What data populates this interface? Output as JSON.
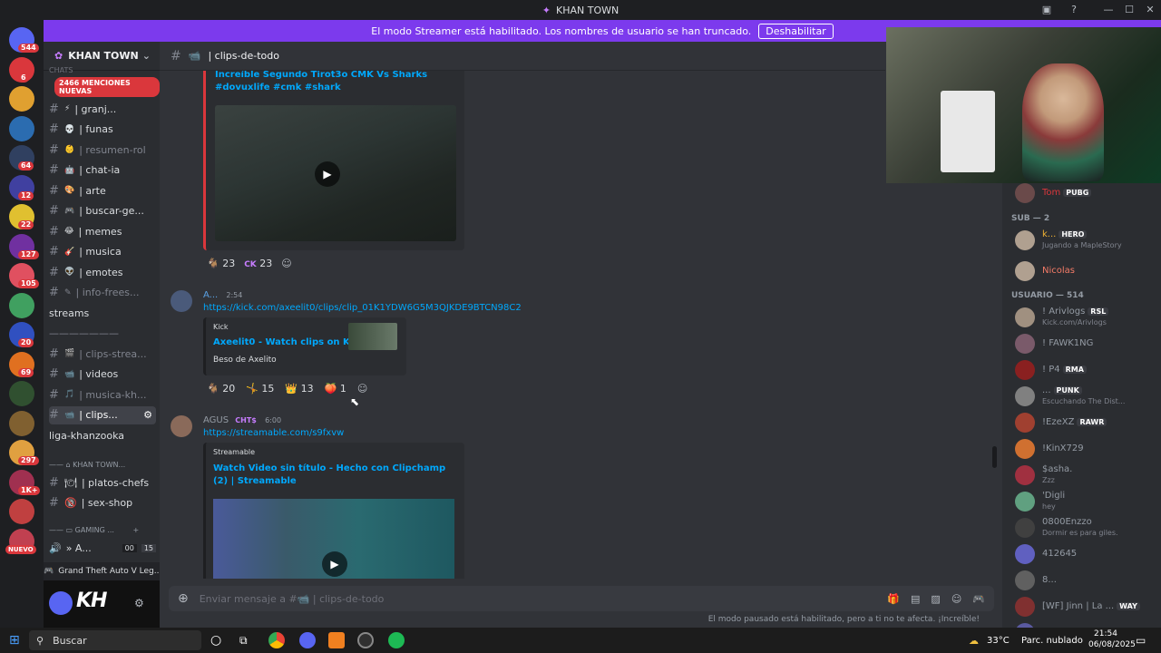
{
  "window": {
    "title": "KHAN TOWN"
  },
  "banner": {
    "text": "El modo Streamer está habilitado. Los nombres de usuario se han truncado.",
    "button": "Deshabilitar"
  },
  "guilds": [
    {
      "badge": "544",
      "color": "#5865f2"
    },
    {
      "badge": "6",
      "color": "#da373c"
    },
    {
      "badge": "",
      "color": "#e0a030"
    },
    {
      "badge": "",
      "color": "#2b6cb0"
    },
    {
      "badge": "64",
      "color": "#304060"
    },
    {
      "badge": "12",
      "color": "#4040a0"
    },
    {
      "badge": "22",
      "color": "#e0c030"
    },
    {
      "badge": "127",
      "color": "#7030a0"
    },
    {
      "badge": "105",
      "color": "#e05060"
    },
    {
      "badge": "",
      "color": "#40a060"
    },
    {
      "badge": "20",
      "color": "#3050c0"
    },
    {
      "badge": "69",
      "color": "#e07020"
    },
    {
      "badge": "",
      "color": "#305030"
    },
    {
      "badge": "",
      "color": "#806030"
    },
    {
      "badge": "297",
      "color": "#e0a040"
    },
    {
      "badge": "1K+",
      "color": "#a03050"
    },
    {
      "badge": "",
      "color": "#c04040"
    },
    {
      "badge": "NUEVO",
      "color": "#c04050"
    }
  ],
  "server": {
    "name": "KHAN TOWN",
    "mentions": "2466 MENCIONES NUEVAS",
    "partial_top": "CHATS"
  },
  "channels": [
    {
      "label": "| granj...",
      "muted": false,
      "emoji": "⚡"
    },
    {
      "label": "| funas",
      "muted": false,
      "emoji": "💀"
    },
    {
      "label": "| resumen-rol",
      "muted": true,
      "emoji": "👶"
    },
    {
      "label": "| chat-ia",
      "muted": false,
      "emoji": "🤖"
    },
    {
      "label": "| arte",
      "muted": false,
      "emoji": "🎨"
    },
    {
      "label": "| buscar-ge...",
      "muted": false,
      "emoji": "🎮"
    },
    {
      "label": "| memes",
      "muted": false,
      "emoji": "😂"
    },
    {
      "label": "| musica",
      "muted": false,
      "emoji": "🎸"
    },
    {
      "label": "| emotes",
      "muted": false,
      "emoji": "👽"
    },
    {
      "label": "| info-frees...",
      "muted": true,
      "emoji": "✎"
    },
    {
      "label": "streams",
      "muted": false,
      "emoji": ""
    },
    {
      "label": "———————",
      "muted": true,
      "emoji": ""
    },
    {
      "label": "| clips-strea...",
      "muted": true,
      "emoji": "🎬"
    },
    {
      "label": "| videos",
      "muted": false,
      "emoji": "📹"
    },
    {
      "label": "| musica-kh...",
      "muted": true,
      "emoji": "🎵"
    },
    {
      "label": "| clips...",
      "muted": false,
      "emoji": "📹"
    },
    {
      "label": "liga-khanzooka",
      "muted": false,
      "emoji": ""
    }
  ],
  "categories": {
    "khan": "KHAN TOWN...",
    "gaming": "GAMING ..."
  },
  "channels2": [
    {
      "label": "| platos-chefs",
      "emoji": "🍽"
    },
    {
      "label": "| sex-shop",
      "emoji": "🔞"
    }
  ],
  "voice": {
    "label": "» A...",
    "counts": [
      "00",
      "15"
    ]
  },
  "activity": {
    "label": "Grand Theft Auto V Leg..."
  },
  "header": {
    "channel": "| clips-de-todo"
  },
  "messages": {
    "m0": {
      "link_text": "Increíble Segundo Tirot3o CMK Vs Sharks #dovuxlife #cmk #shark",
      "reactions": [
        {
          "emoji": "🐐",
          "count": "23"
        },
        {
          "emoji": "CK",
          "count": "23"
        }
      ]
    },
    "m1": {
      "author": "A...",
      "time": "2:54",
      "url": "https://kick.com/axeelit0/clips/clip_01K1YDW6G5M3QJKDE9BTCN98C2",
      "provider": "Kick",
      "title": "Axeelit0 - Watch clips on Kick",
      "desc": "Beso de Axelito",
      "reactions": [
        {
          "emoji": "🐐",
          "count": "20"
        },
        {
          "emoji": "🤸",
          "count": "15"
        },
        {
          "emoji": "👑",
          "count": "13"
        },
        {
          "emoji": "🍑",
          "count": "1"
        }
      ]
    },
    "m2": {
      "author": "AGUS",
      "badge": "CHT$",
      "time": "6:00",
      "url": "https://streamable.com/s9fxvw",
      "provider": "Streamable",
      "title": "Watch Video sin título - Hecho con Clipchamp (2) | Streamable"
    }
  },
  "composer": {
    "placeholder": "Enviar mensaje a #📹 | clips-de-todo"
  },
  "status": {
    "text": "El modo pausado está habilitado, pero a ti no te afecta. ¡Increíble!"
  },
  "members": {
    "top": {
      "name": "Tom",
      "tag": "PUBG"
    },
    "sub_header": "SUB — 2",
    "sub": [
      {
        "name": "k...",
        "tag": "HERO",
        "activity": "Jugando a MapleStory",
        "color": "#f0b232"
      },
      {
        "name": "Nicolas",
        "tag": "",
        "activity": "",
        "color": "#f47b67"
      }
    ],
    "user_header": "USUARIO — 514",
    "users": [
      {
        "name": "! Arivlogs",
        "tag": "RSL",
        "activity": "Kick.com/Arivlogs"
      },
      {
        "name": "! FAWK1NG",
        "tag": "",
        "activity": ""
      },
      {
        "name": "! P4",
        "tag": "RMA",
        "activity": ""
      },
      {
        "name": "...",
        "tag": "PUNK",
        "activity": "Escuchando The Dist..."
      },
      {
        "name": "!EzeXZ",
        "tag": "RAWR",
        "activity": ""
      },
      {
        "name": "!KinX729",
        "tag": "",
        "activity": ""
      },
      {
        "name": "$asha.",
        "tag": "",
        "activity": "Zzz"
      },
      {
        "name": "'Digli",
        "tag": "",
        "activity": "hey"
      },
      {
        "name": "0800Enzzo",
        "tag": "",
        "activity": "Dormir es para giles."
      },
      {
        "name": "412645",
        "tag": "",
        "activity": ""
      },
      {
        "name": "8...",
        "tag": "",
        "activity": ""
      },
      {
        "name": "[WF] Jinn | La ...",
        "tag": "WAY",
        "activity": ""
      },
      {
        "name": "agsal",
        "tag": "",
        "activity": ""
      }
    ]
  },
  "taskbar": {
    "search": "Buscar",
    "weather": "33°C",
    "weather_desc": "Parc. nublado",
    "time": "21:54",
    "date": "06/08/2025"
  }
}
